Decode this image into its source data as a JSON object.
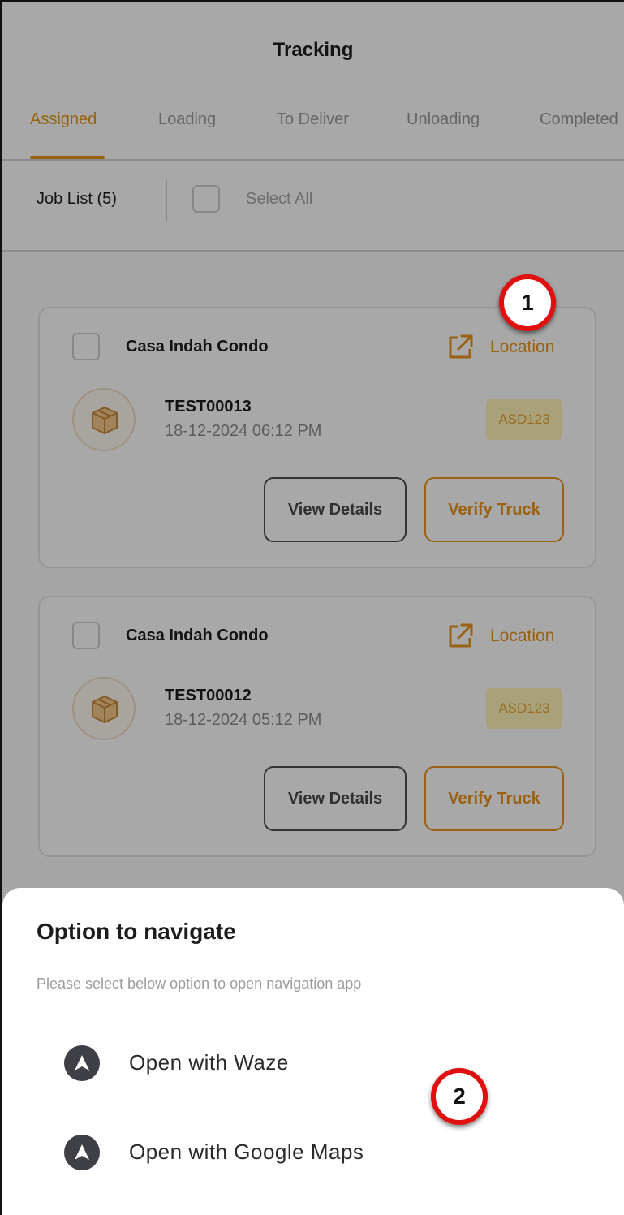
{
  "header": {
    "title": "Tracking"
  },
  "tabs": [
    {
      "label": "Assigned",
      "active": true
    },
    {
      "label": "Loading",
      "active": false
    },
    {
      "label": "To Deliver",
      "active": false
    },
    {
      "label": "Unloading",
      "active": false
    },
    {
      "label": "Completed",
      "active": false
    }
  ],
  "toolbar": {
    "job_count_label": "Job List (5)",
    "select_all_label": "Select All"
  },
  "jobs": [
    {
      "name": "Casa Indah Condo",
      "location_label": "Location",
      "job_id": "TEST00013",
      "datetime": "18-12-2024 06:12 PM",
      "badge": "ASD123",
      "view_label": "View Details",
      "verify_label": "Verify Truck"
    },
    {
      "name": "Casa Indah Condo",
      "location_label": "Location",
      "job_id": "TEST00012",
      "datetime": "18-12-2024 05:12 PM",
      "badge": "ASD123",
      "view_label": "View Details",
      "verify_label": "Verify Truck"
    }
  ],
  "sheet": {
    "title": "Option to navigate",
    "subtitle": "Please select below option to open navigation app",
    "options": [
      {
        "label": "Open with Waze",
        "icon": "navigation-arrow-icon"
      },
      {
        "label": "Open with Google Maps",
        "icon": "navigation-arrow-icon"
      }
    ]
  },
  "markers": [
    "1",
    "2"
  ],
  "colors": {
    "accent": "#e8941a",
    "badge_bg": "#fff4b8",
    "marker_ring": "#e01010",
    "nav_icon": "#3f3f46"
  }
}
